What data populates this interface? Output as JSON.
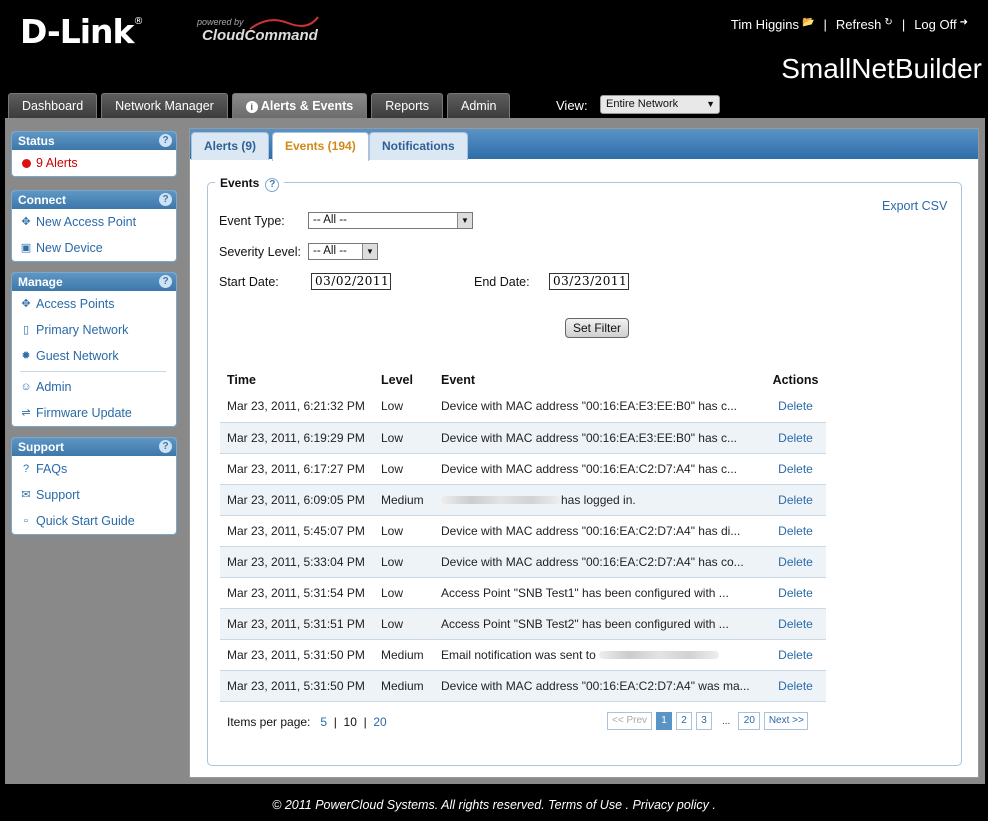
{
  "header": {
    "logo": "D-Link",
    "logo_mark": "®",
    "powered_by": "powered by",
    "cloud_brand": "CloudCommand",
    "user": "Tim Higgins",
    "refresh": "Refresh",
    "logoff": "Log Off",
    "site_name": "SmallNetBuilder"
  },
  "main_tabs": [
    {
      "label": "Dashboard"
    },
    {
      "label": "Network Manager"
    },
    {
      "label": "Alerts & Events"
    },
    {
      "label": "Reports"
    },
    {
      "label": "Admin"
    }
  ],
  "view": {
    "label": "View:",
    "value": "Entire Network"
  },
  "sidebar": {
    "status": {
      "title": "Status",
      "items": [
        {
          "label": "9 Alerts"
        }
      ]
    },
    "connect": {
      "title": "Connect",
      "items": [
        {
          "label": "New Access Point"
        },
        {
          "label": "New Device"
        }
      ]
    },
    "manage": {
      "title": "Manage",
      "items": [
        {
          "label": "Access Points"
        },
        {
          "label": "Primary Network"
        },
        {
          "label": "Guest Network"
        },
        {
          "label": "Admin"
        },
        {
          "label": "Firmware Update"
        }
      ]
    },
    "support": {
      "title": "Support",
      "items": [
        {
          "label": "FAQs"
        },
        {
          "label": "Support"
        },
        {
          "label": "Quick Start Guide"
        }
      ]
    }
  },
  "sub_tabs": [
    {
      "label": "Alerts (9)"
    },
    {
      "label": "Events (194)"
    },
    {
      "label": "Notifications"
    }
  ],
  "events": {
    "title": "Events",
    "export": "Export CSV",
    "event_type_label": "Event Type:",
    "event_type_value": "-- All --",
    "severity_label": "Severity Level:",
    "severity_value": "-- All --",
    "start_label": "Start Date:",
    "start_value": "03/02/2011",
    "end_label": "End Date:",
    "end_value": "03/23/2011",
    "filter_button": "Set Filter",
    "columns": [
      "Time",
      "Level",
      "Event",
      "Actions"
    ],
    "rows": [
      {
        "time": "Mar 23, 2011, 6:21:32 PM",
        "level": "Low",
        "event": "Device with MAC address \"00:16:EA:E3:EE:B0\" has c...",
        "action": "Delete"
      },
      {
        "time": "Mar 23, 2011, 6:19:29 PM",
        "level": "Low",
        "event": "Device with MAC address \"00:16:EA:E3:EE:B0\" has c...",
        "action": "Delete"
      },
      {
        "time": "Mar 23, 2011, 6:17:27 PM",
        "level": "Low",
        "event": "Device with MAC address \"00:16:EA:C2:D7:A4\" has c...",
        "action": "Delete"
      },
      {
        "time": "Mar 23, 2011, 6:09:05 PM",
        "level": "Medium",
        "event": "has logged in.",
        "action": "Delete",
        "redacted_prefix": true
      },
      {
        "time": "Mar 23, 2011, 5:45:07 PM",
        "level": "Low",
        "event": "Device with MAC address \"00:16:EA:C2:D7:A4\" has di...",
        "action": "Delete"
      },
      {
        "time": "Mar 23, 2011, 5:33:04 PM",
        "level": "Low",
        "event": "Device with MAC address \"00:16:EA:C2:D7:A4\" has co...",
        "action": "Delete"
      },
      {
        "time": "Mar 23, 2011, 5:31:54 PM",
        "level": "Low",
        "event": "Access Point \"SNB Test1\" has been configured with ...",
        "action": "Delete"
      },
      {
        "time": "Mar 23, 2011, 5:31:51 PM",
        "level": "Low",
        "event": "Access Point \"SNB Test2\" has been configured with ...",
        "action": "Delete"
      },
      {
        "time": "Mar 23, 2011, 5:31:50 PM",
        "level": "Medium",
        "event": "Email notification was sent to",
        "action": "Delete",
        "redacted_suffix": true
      },
      {
        "time": "Mar 23, 2011, 5:31:50 PM",
        "level": "Medium",
        "event": "Device with MAC address \"00:16:EA:C2:D7:A4\" was ma...",
        "action": "Delete"
      }
    ],
    "items_per_page": {
      "label": "Items per page:",
      "options": [
        "5",
        "10",
        "20"
      ],
      "current": "10"
    },
    "pager": {
      "prev": "<< Prev",
      "pages": [
        "1",
        "2",
        "3"
      ],
      "ellipsis": "...",
      "last": "20",
      "next": "Next >>",
      "current": "1"
    }
  },
  "footer": {
    "text": "© 2011 PowerCloud Systems. All rights reserved. Terms of Use . Privacy policy ."
  }
}
